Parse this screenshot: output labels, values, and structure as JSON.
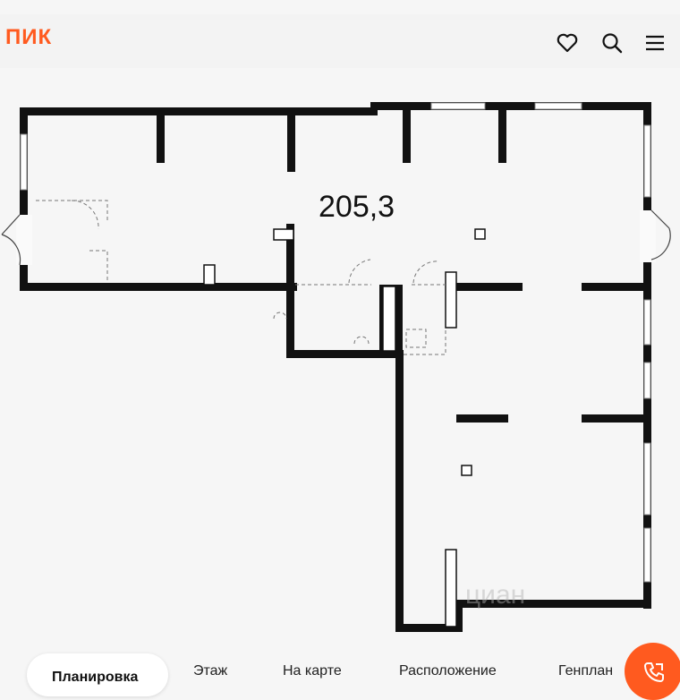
{
  "header": {
    "logo": "ПИК",
    "icons": [
      "heart-icon",
      "search-icon",
      "menu-icon"
    ],
    "brand_color": "#ff5a1f"
  },
  "plan": {
    "area": "205,3",
    "watermark": "циан"
  },
  "tabs": [
    {
      "label": "Планировка",
      "active": true
    },
    {
      "label": "Этаж",
      "active": false
    },
    {
      "label": "На карте",
      "active": false
    },
    {
      "label": "Расположение",
      "active": false
    },
    {
      "label": "Генплан",
      "active": false
    }
  ],
  "call_button": {
    "icon": "phone-callback-icon"
  }
}
